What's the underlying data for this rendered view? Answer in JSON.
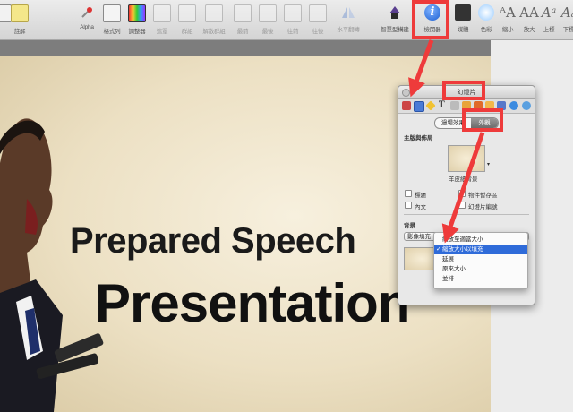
{
  "toolbar": {
    "buttons": [
      {
        "label": "",
        "icon": "slide-icon"
      },
      {
        "label": "註解",
        "icon": "note-icon"
      },
      {
        "label": "Alpha",
        "icon": "alpha-icon"
      },
      {
        "label": "格式列",
        "icon": "format-bar-icon"
      },
      {
        "label": "調整器",
        "icon": "adjust-icon"
      },
      {
        "label": "遮罩",
        "icon": "mask-icon"
      },
      {
        "label": "群組",
        "icon": "group-icon"
      },
      {
        "label": "解散群組",
        "icon": "ungroup-icon"
      },
      {
        "label": "最前",
        "icon": "front-icon"
      },
      {
        "label": "最後",
        "icon": "back-icon"
      },
      {
        "label": "往前",
        "icon": "forward-icon"
      },
      {
        "label": "往後",
        "icon": "backward-icon"
      },
      {
        "label": "水平翻轉",
        "icon": "flip-icon"
      },
      {
        "label": "智慧型構建",
        "icon": "smart-build-icon"
      },
      {
        "label": "檢閱器",
        "icon": "inspector-icon"
      },
      {
        "label": "媒體",
        "icon": "media-icon"
      },
      {
        "label": "色彩",
        "icon": "colors-icon"
      },
      {
        "label": "縮小",
        "icon": "smaller-icon"
      },
      {
        "label": "放大",
        "icon": "bigger-icon"
      },
      {
        "label": "上標",
        "icon": "superscript-icon"
      },
      {
        "label": "下標",
        "icon": "subscript-icon"
      }
    ]
  },
  "slide": {
    "title_line1": "Prepared Speech",
    "title_line2": "Presentation"
  },
  "inspector": {
    "window_title": "幻燈片",
    "segments": [
      "過場效果",
      "外觀"
    ],
    "section_master": "主版與佈局",
    "master_name": "羊皮紙背景",
    "options": [
      "標題",
      "物件暫存區",
      "內文",
      "幻燈片編號"
    ],
    "section_background": "背景",
    "fill_value": "影像填充"
  },
  "fill_menu": {
    "items": [
      "縮放至適當大小",
      "縮放大小以填充",
      "延展",
      "原來大小",
      "並排"
    ],
    "selected_index": 1,
    "checkmark": "✓"
  },
  "colors": {
    "highlight_red": "#ee3b3b",
    "menu_selection": "#2f6bd9",
    "inspector_blue": "#1c5fd1"
  }
}
